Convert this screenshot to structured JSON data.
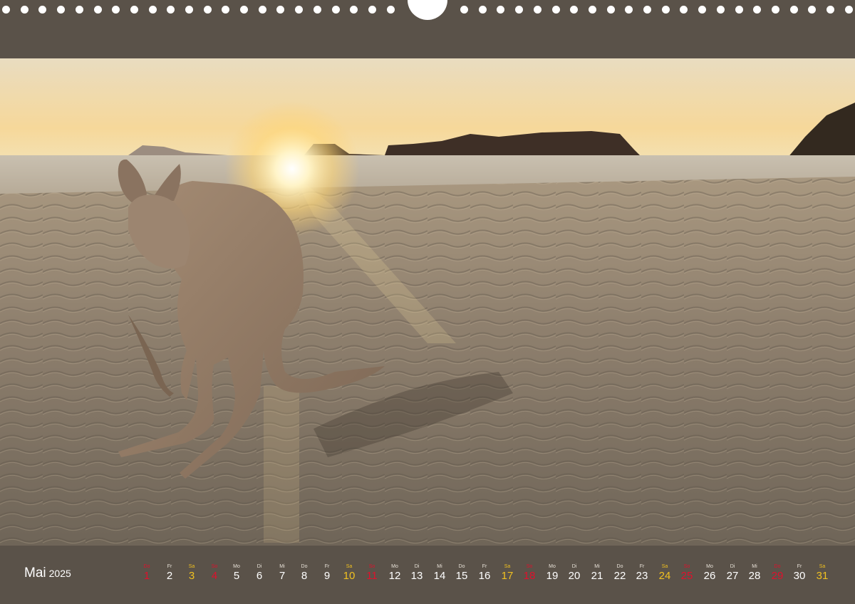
{
  "calendar": {
    "month": "Mai",
    "year": "2025",
    "days": [
      {
        "name": "Do",
        "num": "1",
        "type": "sun"
      },
      {
        "name": "Fr",
        "num": "2",
        "type": "week"
      },
      {
        "name": "Sa",
        "num": "3",
        "type": "sat"
      },
      {
        "name": "So",
        "num": "4",
        "type": "sun"
      },
      {
        "name": "Mo",
        "num": "5",
        "type": "week"
      },
      {
        "name": "Di",
        "num": "6",
        "type": "week"
      },
      {
        "name": "Mi",
        "num": "7",
        "type": "week"
      },
      {
        "name": "Do",
        "num": "8",
        "type": "week"
      },
      {
        "name": "Fr",
        "num": "9",
        "type": "week"
      },
      {
        "name": "Sa",
        "num": "10",
        "type": "sat"
      },
      {
        "name": "So",
        "num": "11",
        "type": "sun"
      },
      {
        "name": "Mo",
        "num": "12",
        "type": "week"
      },
      {
        "name": "Di",
        "num": "13",
        "type": "week"
      },
      {
        "name": "Mi",
        "num": "14",
        "type": "week"
      },
      {
        "name": "Do",
        "num": "15",
        "type": "week"
      },
      {
        "name": "Fr",
        "num": "16",
        "type": "week"
      },
      {
        "name": "Sa",
        "num": "17",
        "type": "sat"
      },
      {
        "name": "So",
        "num": "18",
        "type": "sun"
      },
      {
        "name": "Mo",
        "num": "19",
        "type": "week"
      },
      {
        "name": "Di",
        "num": "20",
        "type": "week"
      },
      {
        "name": "Mi",
        "num": "21",
        "type": "week"
      },
      {
        "name": "Do",
        "num": "22",
        "type": "week"
      },
      {
        "name": "Fr",
        "num": "23",
        "type": "week"
      },
      {
        "name": "Sa",
        "num": "24",
        "type": "sat"
      },
      {
        "name": "So",
        "num": "25",
        "type": "sun"
      },
      {
        "name": "Mo",
        "num": "26",
        "type": "week"
      },
      {
        "name": "Di",
        "num": "27",
        "type": "week"
      },
      {
        "name": "Mi",
        "num": "28",
        "type": "week"
      },
      {
        "name": "Do",
        "num": "29",
        "type": "sun"
      },
      {
        "name": "Fr",
        "num": "30",
        "type": "week"
      },
      {
        "name": "Sa",
        "num": "31",
        "type": "sat"
      }
    ]
  },
  "colors": {
    "frame": "#5a5249",
    "weekday": "#ffffff",
    "saturday": "#f0c020",
    "holiday": "#e0102c"
  },
  "photo": {
    "subject": "kangaroo-on-beach-at-sunrise"
  }
}
